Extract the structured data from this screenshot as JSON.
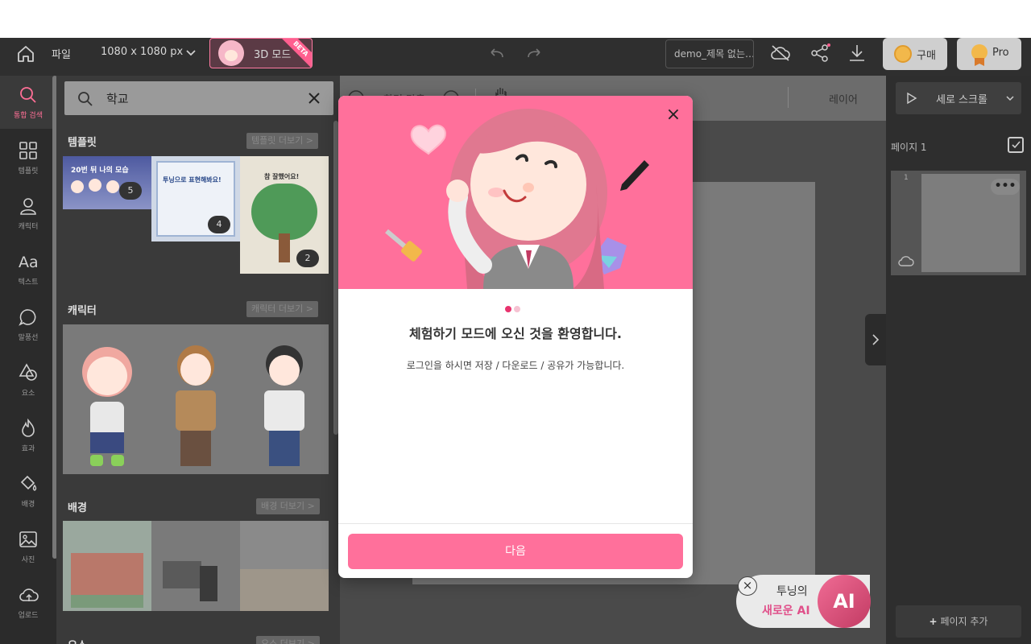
{
  "topbar": {
    "file_label": "파일",
    "size_label": "1080 x 1080 px",
    "mode_label": "3D 모드",
    "beta_label": "BETA",
    "filename": "demo_제목 없는…",
    "buy_label": "구매",
    "pro_label": "Pro"
  },
  "nav": {
    "items": [
      {
        "label": "통합 검색",
        "icon": "search-icon"
      },
      {
        "label": "템플릿",
        "icon": "grid-icon"
      },
      {
        "label": "캐릭터",
        "icon": "person-icon"
      },
      {
        "label": "텍스트",
        "icon": "text-icon"
      },
      {
        "label": "말풍선",
        "icon": "speech-bubble-icon"
      },
      {
        "label": "요소",
        "icon": "shapes-icon"
      },
      {
        "label": "효과",
        "icon": "flame-icon"
      },
      {
        "label": "배경",
        "icon": "paint-bucket-icon"
      },
      {
        "label": "사진",
        "icon": "image-icon"
      },
      {
        "label": "업로드",
        "icon": "cloud-upload-icon"
      }
    ]
  },
  "search": {
    "value": "학교"
  },
  "panel": {
    "sections": [
      {
        "title": "템플릿",
        "more": "템플릿 더보기 >",
        "counts": [
          "5",
          "4",
          "2"
        ]
      },
      {
        "title": "캐릭터",
        "more": "캐릭터 더보기 >"
      },
      {
        "title": "배경",
        "more": "배경 더보기 >"
      },
      {
        "title": "요소",
        "more": "요소 더보기 >"
      }
    ],
    "template_texts": [
      "20번 뒤 나의 모습",
      "투닝으로 표현해봐요!",
      "참 잘했어요!"
    ]
  },
  "center": {
    "tool_label": "화면 맞춤",
    "layer_label": "레이어"
  },
  "right": {
    "scroll_mode": "세로 스크롤",
    "page_label": "페이지 1",
    "page_index": "1",
    "more_label": "•••",
    "add_page": "페이지 추가"
  },
  "ai_badge": {
    "line1": "투닝의",
    "line2": "새로운 AI",
    "circle": "AI"
  },
  "modal": {
    "title": "체험하기 모드에 오신 것을 환영합니다.",
    "description": "로그인을 하시면 저장 / 다운로드 / 공유가 가능합니다.",
    "next_label": "다음",
    "close_symbol": "×",
    "page_dots": 2,
    "active_dot": 0
  },
  "colors": {
    "accent": "#ff709b",
    "dot_active": "#e8336e",
    "dot_inactive": "#f6c2d2"
  }
}
